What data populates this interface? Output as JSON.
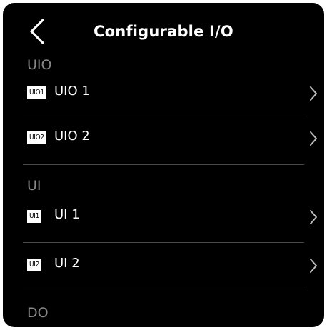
{
  "header": {
    "title": "Configurable I/O"
  },
  "sections": {
    "uio": {
      "label": "UIO",
      "items": [
        {
          "tag": "UIO1",
          "label": "UIO 1"
        },
        {
          "tag": "UIO2",
          "label": "UIO 2"
        }
      ]
    },
    "ui": {
      "label": "UI",
      "items": [
        {
          "tag": "UI1",
          "label": "UI 1"
        },
        {
          "tag": "UI2",
          "label": "UI 2"
        }
      ]
    },
    "do": {
      "label": "DO"
    }
  },
  "icons": {
    "back": "chevron-left-icon",
    "row_arrow": "chevron-right-icon"
  },
  "colors": {
    "background": "#000000",
    "text": "#ffffff",
    "section_text": "#8a8a8a",
    "divider": "#4a4a4a"
  }
}
